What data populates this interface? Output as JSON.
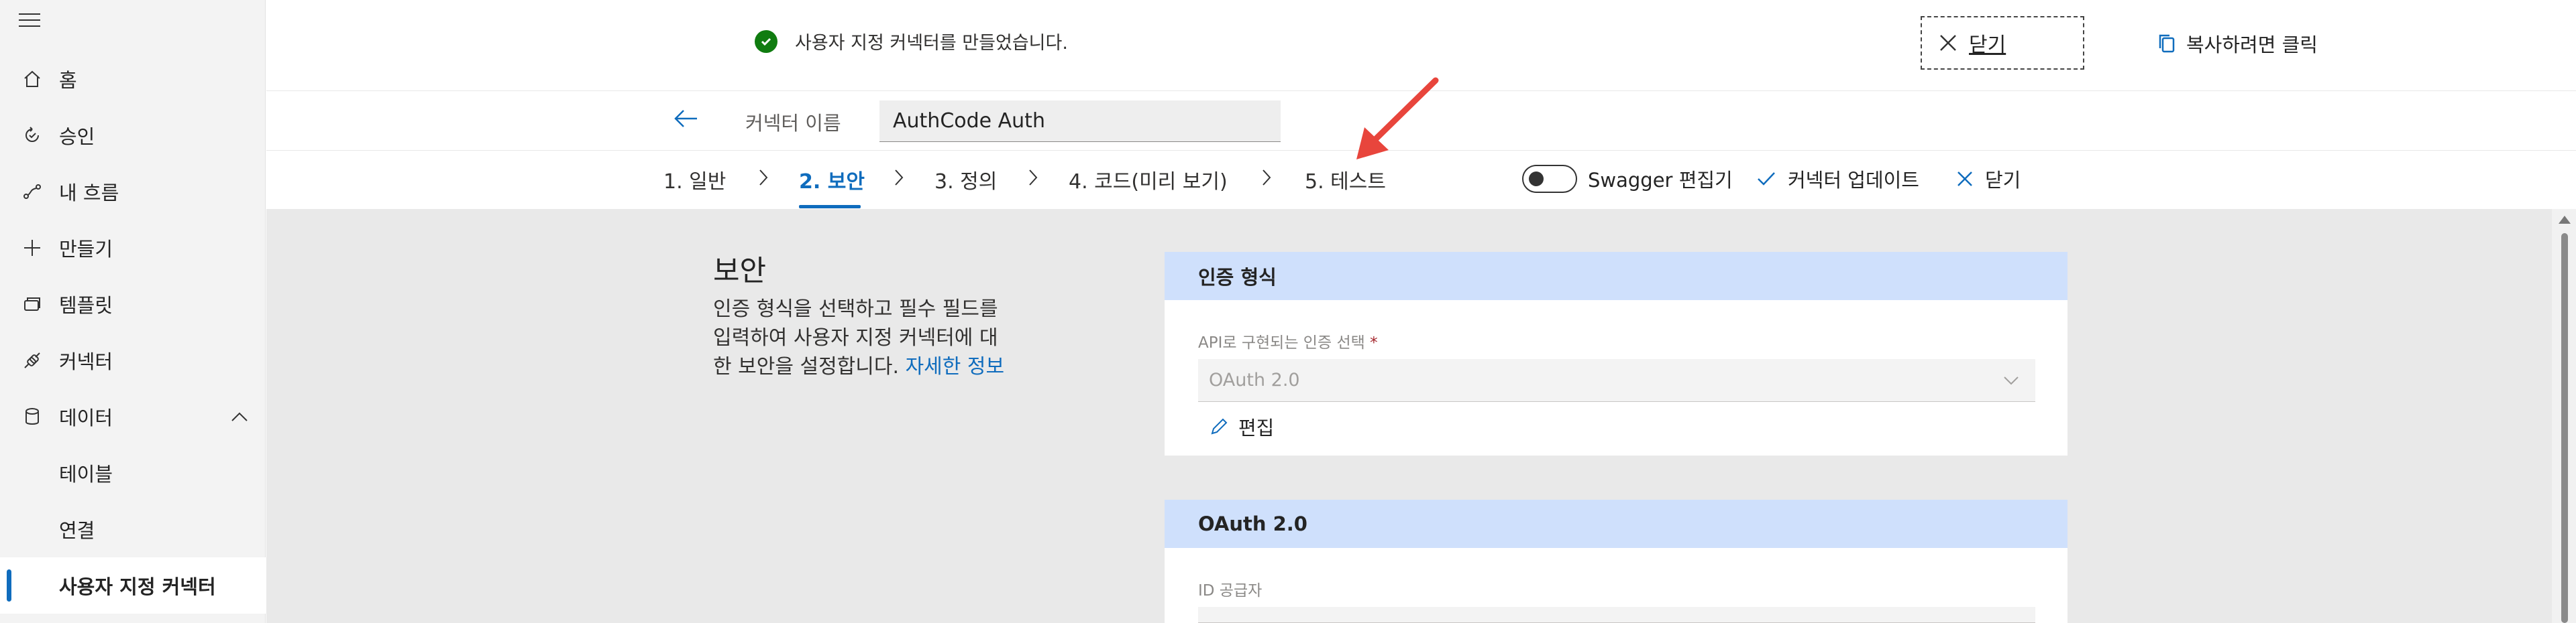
{
  "sidebar": {
    "items": [
      {
        "label": "홈",
        "icon": "home-icon"
      },
      {
        "label": "승인",
        "icon": "approvals-icon"
      },
      {
        "label": "내 흐름",
        "icon": "flow-icon"
      },
      {
        "label": "만들기",
        "icon": "plus-icon"
      },
      {
        "label": "템플릿",
        "icon": "templates-icon"
      },
      {
        "label": "커넥터",
        "icon": "connector-icon"
      },
      {
        "label": "데이터",
        "icon": "database-icon"
      },
      {
        "label": "테이블"
      },
      {
        "label": "연결"
      },
      {
        "label": "사용자 지정 커넥터"
      }
    ]
  },
  "banner": {
    "message": "사용자 지정 커넥터를 만들었습니다.",
    "close_label": "닫기",
    "copy_label": "복사하려면 클릭"
  },
  "connector": {
    "name_label": "커넥터 이름",
    "name_value": "AuthCode Auth"
  },
  "steps": [
    {
      "label": "1. 일반"
    },
    {
      "label": "2. 보안"
    },
    {
      "label": "3. 정의"
    },
    {
      "label": "4. 코드(미리 보기)"
    },
    {
      "label": "5. 테스트"
    }
  ],
  "toolbar": {
    "swagger_label": "Swagger 편집기",
    "update_label": "커넥터 업데이트",
    "close_label": "닫기"
  },
  "security": {
    "title": "보안",
    "desc_line1": "인증 형식을 선택하고 필수 필드를",
    "desc_line2": "입력하여 사용자 지정 커넥터에 대",
    "desc_line3": "한 보안을 설정합니다.",
    "learn_more": "자세한 정보"
  },
  "auth_card": {
    "header": "인증 형식",
    "field_label": "API로 구현되는 인증 선택",
    "required_mark": "*",
    "selected_value": "OAuth 2.0",
    "edit_label": "편집"
  },
  "oauth_card": {
    "header": "OAuth 2.0",
    "field_label": "ID 공급자"
  },
  "colors": {
    "accent": "#0f6cbd",
    "success": "#107c10",
    "card_header": "#cfe0fc",
    "annotation_arrow": "#e8453c"
  }
}
